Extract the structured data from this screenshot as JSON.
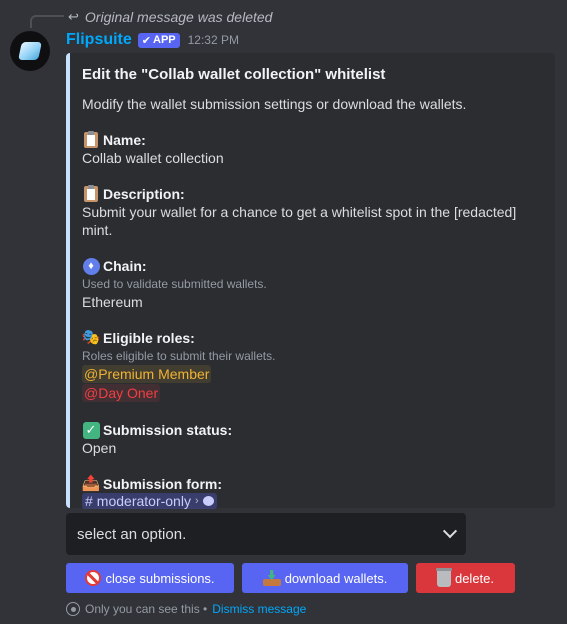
{
  "reply": {
    "text": "Original message was deleted"
  },
  "message": {
    "author": "Flipsuite",
    "badge": "APP",
    "timestamp": "12:32 PM"
  },
  "embed": {
    "accent_color": "#c9e1ff",
    "title": "Edit the \"Collab wallet collection\" whitelist",
    "description": "Modify the wallet submission settings or download the wallets.",
    "fields": {
      "name": {
        "label": "Name:",
        "icon": "clipboard-icon",
        "value": "Collab wallet collection"
      },
      "description": {
        "label": "Description:",
        "icon": "clipboard-icon",
        "value": "Submit your wallet for a chance to get a whitelist spot in the [redacted] mint."
      },
      "chain": {
        "label": "Chain:",
        "icon": "ethereum-icon",
        "sub": "Used to validate submitted wallets.",
        "value": "Ethereum"
      },
      "roles": {
        "label": "Eligible roles:",
        "icon": "performing-arts-icon",
        "sub": "Roles eligible to submit their wallets.",
        "role1": "@Premium Member",
        "role2": "@Day Oner"
      },
      "status": {
        "label": "Submission status:",
        "icon": "check-mark-icon",
        "value": "Open"
      },
      "form": {
        "label": "Submission form:",
        "icon": "outbox-tray-icon",
        "channel": "moderator-only"
      }
    }
  },
  "select": {
    "placeholder": "select an option."
  },
  "buttons": {
    "close": "close submissions.",
    "download": "download wallets.",
    "delete": "delete."
  },
  "footer": {
    "notice": "Only you can see this •",
    "dismiss": "Dismiss message"
  }
}
